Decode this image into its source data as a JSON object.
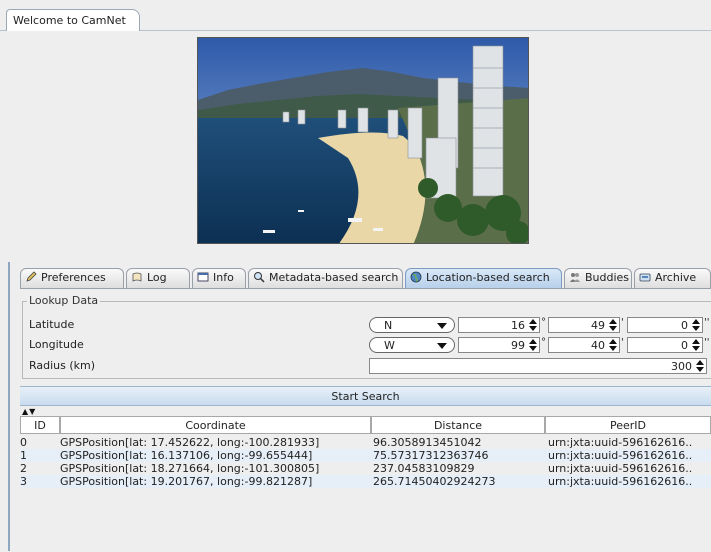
{
  "window": {
    "tab_title": "Welcome to CamNet"
  },
  "photo": {
    "subject": "beach-city-photo"
  },
  "tabs": [
    {
      "label": "Preferences",
      "icon": "pencil-icon",
      "active": false
    },
    {
      "label": "Log",
      "icon": "scroll-icon",
      "active": false
    },
    {
      "label": "Info",
      "icon": "window-icon",
      "active": false
    },
    {
      "label": "Metadata-based search",
      "icon": "magnifier-icon",
      "active": false
    },
    {
      "label": "Location-based search",
      "icon": "globe-icon",
      "active": true
    },
    {
      "label": "Buddies",
      "icon": "people-icon",
      "active": false
    },
    {
      "label": "Archive",
      "icon": "drive-icon",
      "active": false
    }
  ],
  "lookup": {
    "title": "Lookup Data",
    "latitude": {
      "label": "Latitude",
      "hemisphere": "N",
      "deg": "16",
      "min": "49",
      "sec": "0"
    },
    "longitude": {
      "label": "Longitude",
      "hemisphere": "W",
      "deg": "99",
      "min": "40",
      "sec": "0"
    },
    "radius": {
      "label": "Radius (km)",
      "value": "300"
    },
    "units": {
      "deg": "°",
      "min": "'",
      "sec": "''"
    }
  },
  "search_button": {
    "label": "Start Search"
  },
  "table": {
    "sort_indicator": "▲▼",
    "columns": [
      "ID",
      "Coordinate",
      "Distance",
      "PeerID"
    ],
    "rows": [
      [
        "0",
        "GPSPosition[lat: 17.452622, long:-100.281933]",
        "96.3058913451042",
        "urn:jxta:uuid-596162616.."
      ],
      [
        "1",
        "GPSPosition[lat: 16.137106, long:-99.655444]",
        "75.57317312363746",
        "urn:jxta:uuid-596162616.."
      ],
      [
        "2",
        "GPSPosition[lat: 18.271664, long:-101.300805]",
        "237.04583109829",
        "urn:jxta:uuid-596162616.."
      ],
      [
        "3",
        "GPSPosition[lat: 19.201767, long:-99.821287]",
        "265.71450402924273",
        "urn:jxta:uuid-596162616.."
      ]
    ]
  },
  "colors": {
    "active_tab": "#b8d0ea",
    "alt_row": "#e6eef8",
    "panel_accent": "#8fa6c0"
  }
}
